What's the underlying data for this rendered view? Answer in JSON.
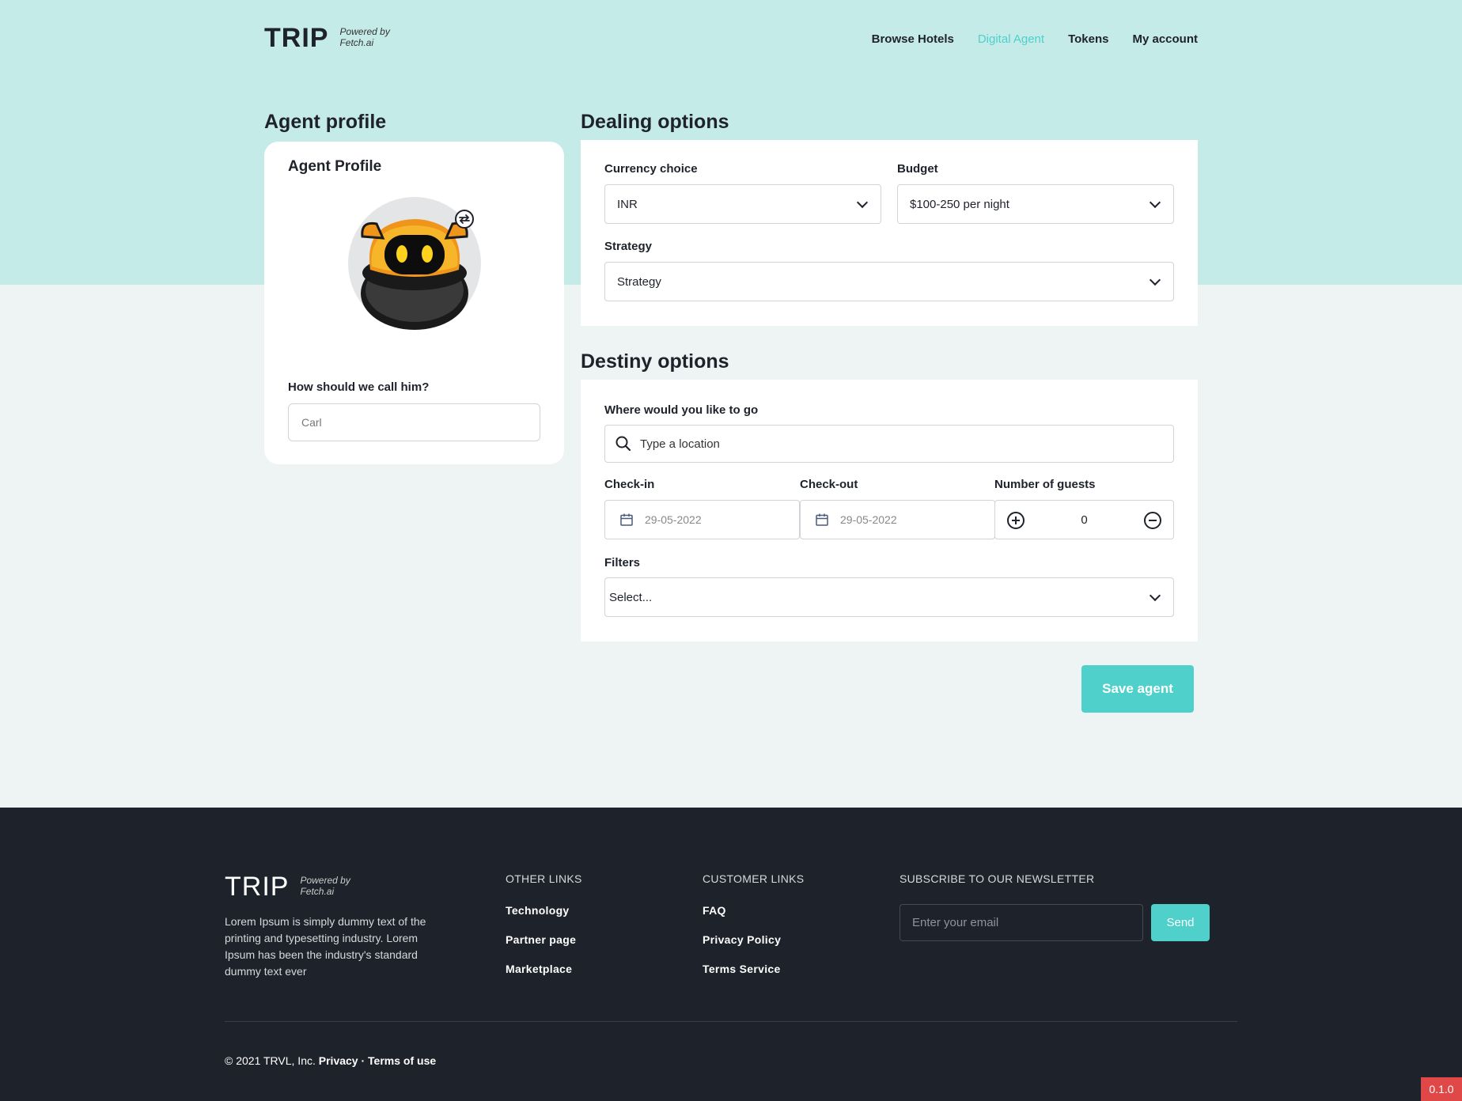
{
  "header": {
    "logo": "TRIP",
    "powered_by_line1": "Powered by",
    "powered_by_line2": "Fetch.ai",
    "nav": [
      {
        "label": "Browse Hotels",
        "active": false
      },
      {
        "label": "Digital Agent",
        "active": true
      },
      {
        "label": "Tokens",
        "active": false
      },
      {
        "label": "My account",
        "active": false
      }
    ]
  },
  "agent": {
    "section_title": "Agent profile",
    "card_title": "Agent Profile",
    "name_label": "How should we call him?",
    "name_placeholder": "Carl"
  },
  "dealing": {
    "section_title": "Dealing options",
    "currency_label": "Currency choice",
    "currency_value": "INR",
    "budget_label": "Budget",
    "budget_value": "$100-250 per night",
    "strategy_label": "Strategy",
    "strategy_value": "Strategy"
  },
  "destiny": {
    "section_title": "Destiny options",
    "location_label": "Where would you like to go",
    "location_placeholder": "Type a location",
    "checkin_label": "Check-in",
    "checkin_value": "29-05-2022",
    "checkout_label": "Check-out",
    "checkout_value": "29-05-2022",
    "guests_label": "Number of guests",
    "guests_value": "0",
    "filters_label": "Filters",
    "filters_value": "Select..."
  },
  "save_label": "Save agent",
  "footer": {
    "logo": "TRIP",
    "powered_by_line1": "Powered by",
    "powered_by_line2": "Fetch.ai",
    "description": "Lorem Ipsum is simply dummy text of the printing and typesetting industry. Lorem Ipsum has been the industry's standard dummy text ever",
    "other_links_title": "OTHER LINKS",
    "other_links": [
      "Technology",
      "Partner page",
      "Marketplace"
    ],
    "customer_links_title": "CUSTOMER LINKS",
    "customer_links": [
      "FAQ",
      "Privacy Policy",
      "Terms Service"
    ],
    "newsletter_title": "SUBSCRIBE TO OUR NEWSLETTER",
    "email_placeholder": "Enter your email",
    "send_label": "Send",
    "copyright": "© 2021 TRVL, Inc.",
    "privacy": "Privacy",
    "separator": " · ",
    "terms": "Terms of use"
  },
  "version": "0.1.0",
  "colors": {
    "accent": "#4fd0cb",
    "hero_bg": "#c5ebe9",
    "page_bg": "#edf4f3",
    "footer_bg": "#1e222a"
  }
}
